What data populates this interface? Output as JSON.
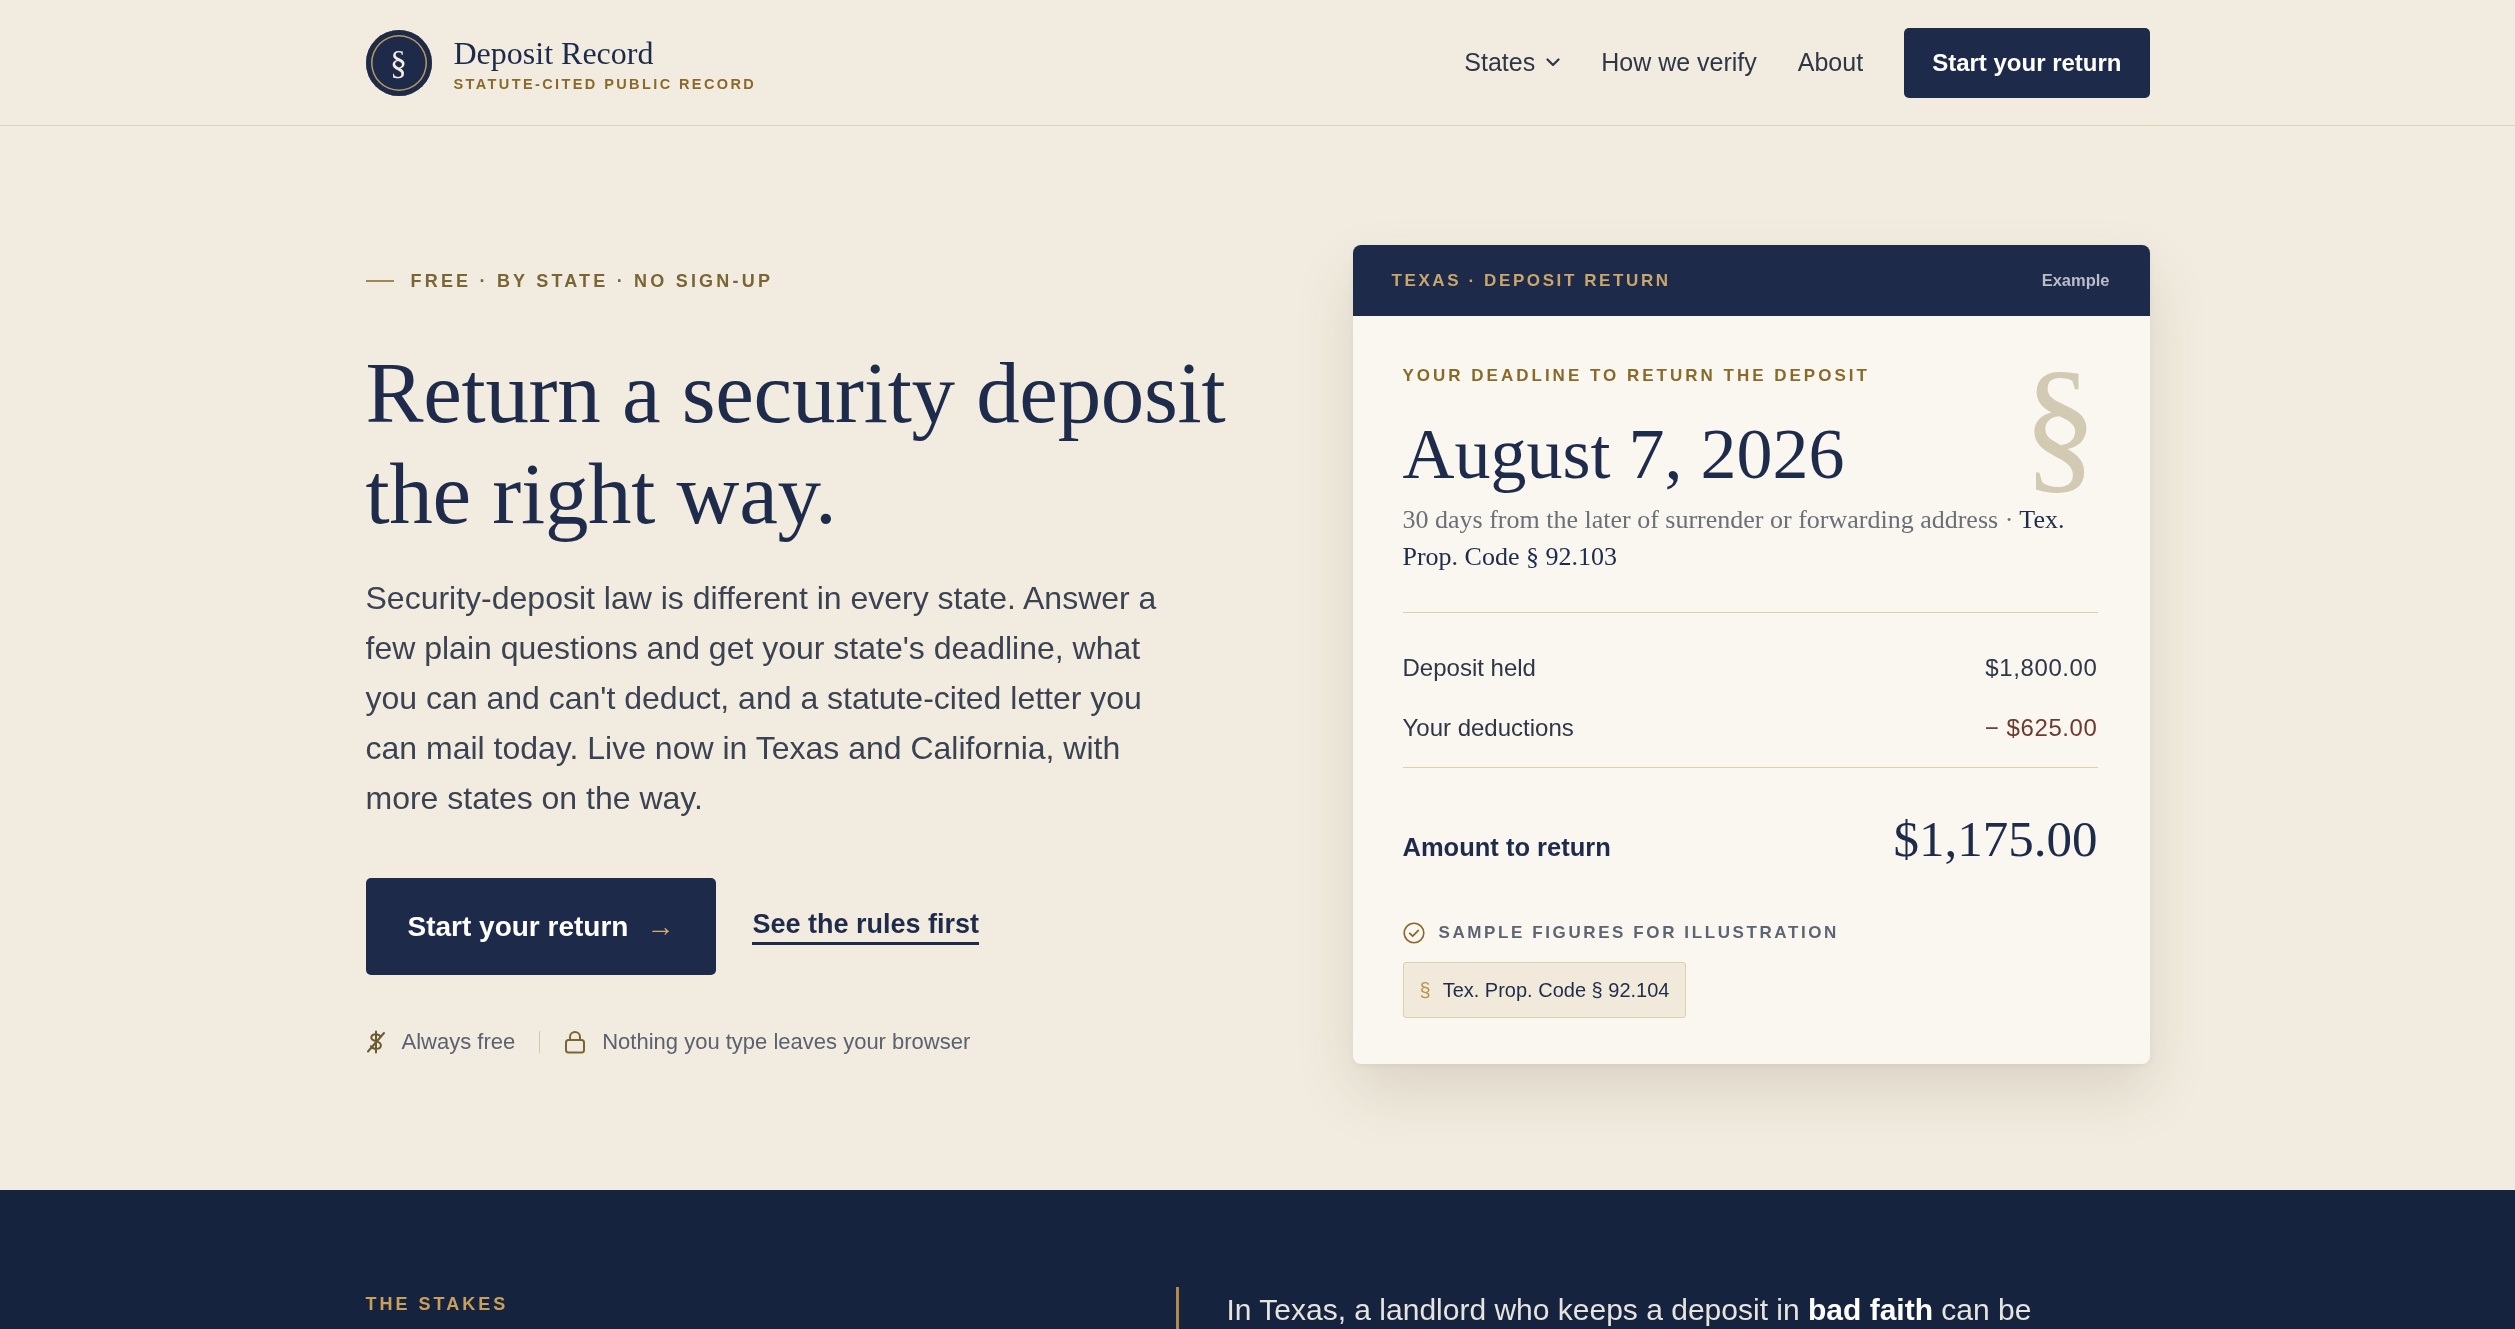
{
  "header": {
    "logo": {
      "mark": "§",
      "title": "Deposit Record",
      "tagline": "STATUTE-CITED PUBLIC RECORD"
    },
    "nav": [
      {
        "label": "States",
        "kind": "menu"
      },
      {
        "label": "How we verify",
        "kind": "link"
      },
      {
        "label": "About",
        "kind": "link"
      }
    ],
    "cta": {
      "label": "Start your return"
    }
  },
  "hero": {
    "eyebrow": "FREE · BY STATE · NO SIGN-UP",
    "heading": "Return a security deposit the right way.",
    "lede": "Security-deposit law is different in every state. Answer a few plain questions and get your state's deadline, what you can and can't deduct, and a statute-cited letter you can mail today. Live now in Texas and California, with more states on the way.",
    "primary_button": {
      "label": "Start your return",
      "arrow": "→"
    },
    "secondary_link": {
      "label": "See the rules first"
    },
    "assurances": [
      {
        "kind": "free",
        "text": "Always free"
      },
      {
        "kind": "private",
        "text": "Nothing you type leaves your browser"
      }
    ]
  },
  "example_card": {
    "title": "TEXAS · DEPOSIT RETURN",
    "badge": "Example",
    "watermark": "§",
    "deadline_label": "YOUR DEADLINE TO RETURN THE DEPOSIT",
    "deadline": "August 7, 2026",
    "basis": "30 days from the later of surrender or forwarding address ·",
    "basis_citation": "Tex. Prop. Code § 92.103",
    "lines": [
      {
        "kind": "amount",
        "label": "Deposit held",
        "amount": "$1,800.00"
      },
      {
        "kind": "deduction",
        "label": "Your deductions",
        "amount": "− $625.00"
      }
    ],
    "total": {
      "label": "Amount to return",
      "amount": "$1,175.00"
    },
    "note": "SAMPLE FIGURES FOR ILLUSTRATION",
    "citation": {
      "mark": "§",
      "text": "Tex. Prop. Code § 92.104"
    }
  },
  "stakes": {
    "eyebrow": "THE STAKES",
    "text": "In Texas, a landlord who keeps a deposit in **bad faith** can be"
  }
}
